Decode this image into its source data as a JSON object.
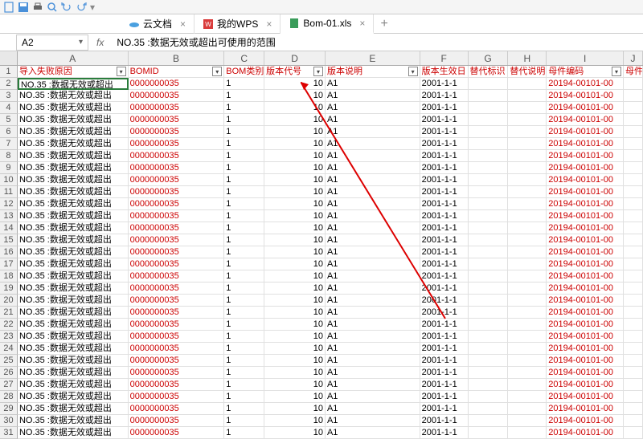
{
  "tabs": [
    {
      "label": "云文档",
      "icon": "cloud"
    },
    {
      "label": "我的WPS",
      "icon": "wps"
    },
    {
      "label": "Bom-01.xls",
      "icon": "xls"
    }
  ],
  "cell_ref": "A2",
  "formula_value": "NO.35 :数据无效或超出可使用的范围",
  "columns": [
    "A",
    "B",
    "C",
    "D",
    "E",
    "F",
    "G",
    "H",
    "I",
    "J"
  ],
  "headers": {
    "A": "导入失败原因",
    "B": "BOMID",
    "C": "BOM类别",
    "D": "版本代号",
    "E": "版本说明",
    "F": "版本生效日",
    "G": "替代标识",
    "H": "替代说明",
    "I": "母件编码",
    "J": "母件"
  },
  "row_data": {
    "A": "NO.35 :数据无效或超出",
    "B": "0000000035",
    "C": "1",
    "D": "10",
    "E": "A1",
    "F": "2001-1-1",
    "G": "",
    "H": "",
    "I": "20194-00101-00"
  },
  "row_count": 30
}
